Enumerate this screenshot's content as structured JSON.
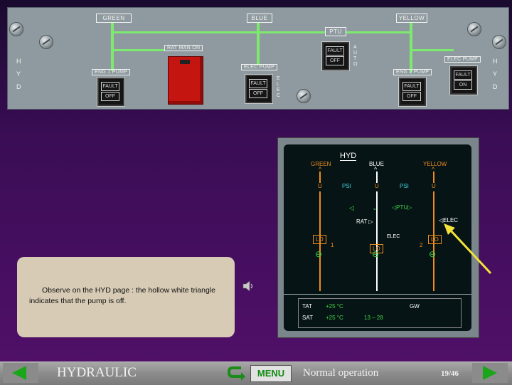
{
  "overhead_panel": {
    "side_letters_left": [
      "H",
      "Y",
      "D"
    ],
    "side_letters_right": [
      "H",
      "Y",
      "D"
    ],
    "systems": {
      "green": "GREEN",
      "blue": "BLUE",
      "yellow": "YELLOW"
    },
    "ptu_label": "PTU",
    "rat_label": "RAT MAN ON",
    "auto_label": [
      "A",
      "U",
      "T",
      "O"
    ],
    "elec_label": [
      "E",
      "L",
      "E",
      "C"
    ],
    "eng1_pump": {
      "label": "ENG 1 PUMP",
      "fault": "FAULT",
      "state": "OFF"
    },
    "blue_elec_pump": {
      "label": "ELEC PUMP",
      "fault": "FAULT",
      "state": "OFF"
    },
    "ptu_button": {
      "fault": "FAULT",
      "state": "OFF"
    },
    "eng2_pump": {
      "label": "ENG 2 PUMP",
      "fault": "FAULT",
      "state": "OFF"
    },
    "yellow_elec_pump": {
      "label": "ELEC PUMP",
      "fault": "FAULT",
      "state": "ON"
    }
  },
  "ecam": {
    "title": "HYD",
    "green": "GREEN",
    "blue": "BLUE",
    "yellow": "YELLOW",
    "psi1": "PSI",
    "psi2": "PSI",
    "u_green": "U",
    "u_blue": "U",
    "u_yellow": "U",
    "ptu": "PTU",
    "rat": "RAT",
    "elec_yellow": "ELEC",
    "elec_blue": "ELEC",
    "lo_green": "LO",
    "lo_blue": "LO",
    "lo_yellow": "LO",
    "eng1": "1",
    "eng2": "2",
    "tat": "TAT",
    "tat_val": "+25 °C",
    "sat": "SAT",
    "sat_val": "+25 °C",
    "time": "13 – 28",
    "gw": "GW"
  },
  "note": {
    "text": "Observe on the HYD page : the hollow white triangle indicates that the pump is off."
  },
  "bottom_bar": {
    "module_title": "HYDRAULIC",
    "menu_label": "MENU",
    "section_title": "Normal operation",
    "page_counter": "19/46"
  },
  "colors": {
    "green_line": "#7dea6f",
    "ecam_green": "#3fd348",
    "ecam_amber": "#f08c1c",
    "ecam_cyan": "#3fd1d8",
    "nav_arrow": "#19a619",
    "background_purple": "#52106a",
    "arrow_yellow": "#f2e23a"
  },
  "icons": {
    "prev": "left-arrow-icon",
    "next": "right-arrow-icon",
    "menu": "menu-return-icon",
    "sound": "speaker-icon"
  }
}
